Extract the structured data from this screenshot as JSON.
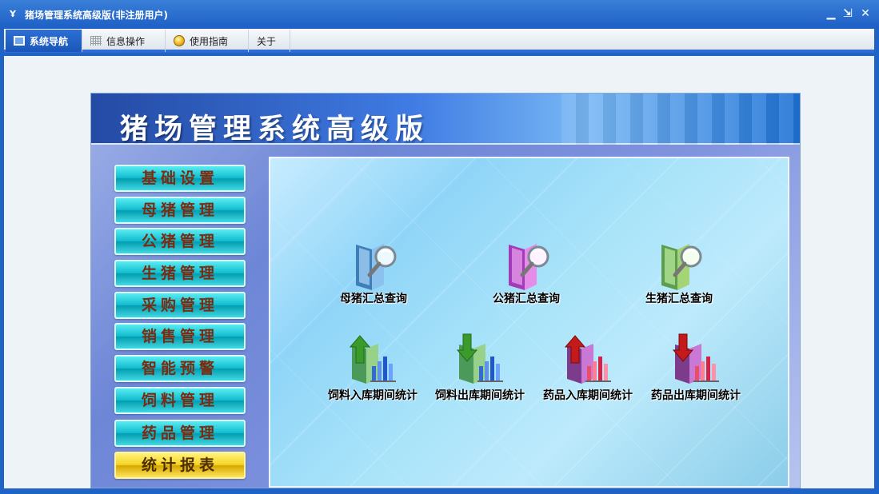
{
  "window": {
    "title": "猪场管理系统高级版(非注册用户)",
    "icon": "app-logo-icon",
    "controls": [
      "minimize-icon",
      "restore-icon",
      "close-icon"
    ]
  },
  "menubar": {
    "tabs": [
      {
        "label": "系统导航",
        "icon": "navigation-icon",
        "active": true
      },
      {
        "label": "信息操作",
        "icon": "grid-icon",
        "active": false
      },
      {
        "label": "使用指南",
        "icon": "coin-icon",
        "active": false
      },
      {
        "label": "关于",
        "icon": "",
        "active": false
      }
    ]
  },
  "main": {
    "title": "猪场管理系统高级版",
    "sidebar": {
      "items": [
        {
          "label": "基础设置",
          "active": false
        },
        {
          "label": "母猪管理",
          "active": false
        },
        {
          "label": "公猪管理",
          "active": false
        },
        {
          "label": "生猪管理",
          "active": false
        },
        {
          "label": "采购管理",
          "active": false
        },
        {
          "label": "销售管理",
          "active": false
        },
        {
          "label": "智能预警",
          "active": false
        },
        {
          "label": "饲料管理",
          "active": false
        },
        {
          "label": "药品管理",
          "active": false
        },
        {
          "label": "统计报表",
          "active": true
        }
      ]
    },
    "reports": {
      "queries": [
        {
          "label": "母猪汇总查询",
          "icon": "blue-folder-magnifier-icon"
        },
        {
          "label": "公猪汇总查询",
          "icon": "pink-folder-magnifier-icon"
        },
        {
          "label": "生猪汇总查询",
          "icon": "green-folder-magnifier-icon"
        }
      ],
      "statistics": [
        {
          "label": "饲料入库期间统计",
          "icon": "green-up-arrow-chart-icon"
        },
        {
          "label": "饲料出库期间统计",
          "icon": "green-down-arrow-chart-icon"
        },
        {
          "label": "药品入库期间统计",
          "icon": "red-up-arrow-chart-icon"
        },
        {
          "label": "药品出库期间统计",
          "icon": "red-down-arrow-chart-icon"
        }
      ]
    }
  },
  "colors": {
    "title_bar": "#1f63c7",
    "active_tab": "#1b56b8",
    "side_button": "#12bdd0",
    "active_side_button": "#f6d323",
    "button_text": "#7a2b10"
  }
}
